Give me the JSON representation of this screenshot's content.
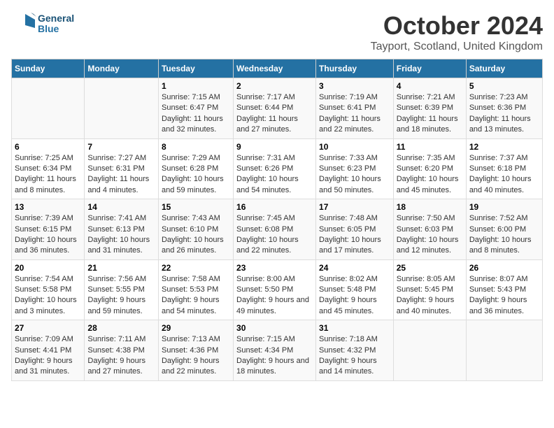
{
  "logo": {
    "line1": "General",
    "line2": "Blue"
  },
  "title": "October 2024",
  "subtitle": "Tayport, Scotland, United Kingdom",
  "headers": [
    "Sunday",
    "Monday",
    "Tuesday",
    "Wednesday",
    "Thursday",
    "Friday",
    "Saturday"
  ],
  "weeks": [
    [
      {
        "day": "",
        "sunrise": "",
        "sunset": "",
        "daylight": ""
      },
      {
        "day": "",
        "sunrise": "",
        "sunset": "",
        "daylight": ""
      },
      {
        "day": "1",
        "sunrise": "Sunrise: 7:15 AM",
        "sunset": "Sunset: 6:47 PM",
        "daylight": "Daylight: 11 hours and 32 minutes."
      },
      {
        "day": "2",
        "sunrise": "Sunrise: 7:17 AM",
        "sunset": "Sunset: 6:44 PM",
        "daylight": "Daylight: 11 hours and 27 minutes."
      },
      {
        "day": "3",
        "sunrise": "Sunrise: 7:19 AM",
        "sunset": "Sunset: 6:41 PM",
        "daylight": "Daylight: 11 hours and 22 minutes."
      },
      {
        "day": "4",
        "sunrise": "Sunrise: 7:21 AM",
        "sunset": "Sunset: 6:39 PM",
        "daylight": "Daylight: 11 hours and 18 minutes."
      },
      {
        "day": "5",
        "sunrise": "Sunrise: 7:23 AM",
        "sunset": "Sunset: 6:36 PM",
        "daylight": "Daylight: 11 hours and 13 minutes."
      }
    ],
    [
      {
        "day": "6",
        "sunrise": "Sunrise: 7:25 AM",
        "sunset": "Sunset: 6:34 PM",
        "daylight": "Daylight: 11 hours and 8 minutes."
      },
      {
        "day": "7",
        "sunrise": "Sunrise: 7:27 AM",
        "sunset": "Sunset: 6:31 PM",
        "daylight": "Daylight: 11 hours and 4 minutes."
      },
      {
        "day": "8",
        "sunrise": "Sunrise: 7:29 AM",
        "sunset": "Sunset: 6:28 PM",
        "daylight": "Daylight: 10 hours and 59 minutes."
      },
      {
        "day": "9",
        "sunrise": "Sunrise: 7:31 AM",
        "sunset": "Sunset: 6:26 PM",
        "daylight": "Daylight: 10 hours and 54 minutes."
      },
      {
        "day": "10",
        "sunrise": "Sunrise: 7:33 AM",
        "sunset": "Sunset: 6:23 PM",
        "daylight": "Daylight: 10 hours and 50 minutes."
      },
      {
        "day": "11",
        "sunrise": "Sunrise: 7:35 AM",
        "sunset": "Sunset: 6:20 PM",
        "daylight": "Daylight: 10 hours and 45 minutes."
      },
      {
        "day": "12",
        "sunrise": "Sunrise: 7:37 AM",
        "sunset": "Sunset: 6:18 PM",
        "daylight": "Daylight: 10 hours and 40 minutes."
      }
    ],
    [
      {
        "day": "13",
        "sunrise": "Sunrise: 7:39 AM",
        "sunset": "Sunset: 6:15 PM",
        "daylight": "Daylight: 10 hours and 36 minutes."
      },
      {
        "day": "14",
        "sunrise": "Sunrise: 7:41 AM",
        "sunset": "Sunset: 6:13 PM",
        "daylight": "Daylight: 10 hours and 31 minutes."
      },
      {
        "day": "15",
        "sunrise": "Sunrise: 7:43 AM",
        "sunset": "Sunset: 6:10 PM",
        "daylight": "Daylight: 10 hours and 26 minutes."
      },
      {
        "day": "16",
        "sunrise": "Sunrise: 7:45 AM",
        "sunset": "Sunset: 6:08 PM",
        "daylight": "Daylight: 10 hours and 22 minutes."
      },
      {
        "day": "17",
        "sunrise": "Sunrise: 7:48 AM",
        "sunset": "Sunset: 6:05 PM",
        "daylight": "Daylight: 10 hours and 17 minutes."
      },
      {
        "day": "18",
        "sunrise": "Sunrise: 7:50 AM",
        "sunset": "Sunset: 6:03 PM",
        "daylight": "Daylight: 10 hours and 12 minutes."
      },
      {
        "day": "19",
        "sunrise": "Sunrise: 7:52 AM",
        "sunset": "Sunset: 6:00 PM",
        "daylight": "Daylight: 10 hours and 8 minutes."
      }
    ],
    [
      {
        "day": "20",
        "sunrise": "Sunrise: 7:54 AM",
        "sunset": "Sunset: 5:58 PM",
        "daylight": "Daylight: 10 hours and 3 minutes."
      },
      {
        "day": "21",
        "sunrise": "Sunrise: 7:56 AM",
        "sunset": "Sunset: 5:55 PM",
        "daylight": "Daylight: 9 hours and 59 minutes."
      },
      {
        "day": "22",
        "sunrise": "Sunrise: 7:58 AM",
        "sunset": "Sunset: 5:53 PM",
        "daylight": "Daylight: 9 hours and 54 minutes."
      },
      {
        "day": "23",
        "sunrise": "Sunrise: 8:00 AM",
        "sunset": "Sunset: 5:50 PM",
        "daylight": "Daylight: 9 hours and 49 minutes."
      },
      {
        "day": "24",
        "sunrise": "Sunrise: 8:02 AM",
        "sunset": "Sunset: 5:48 PM",
        "daylight": "Daylight: 9 hours and 45 minutes."
      },
      {
        "day": "25",
        "sunrise": "Sunrise: 8:05 AM",
        "sunset": "Sunset: 5:45 PM",
        "daylight": "Daylight: 9 hours and 40 minutes."
      },
      {
        "day": "26",
        "sunrise": "Sunrise: 8:07 AM",
        "sunset": "Sunset: 5:43 PM",
        "daylight": "Daylight: 9 hours and 36 minutes."
      }
    ],
    [
      {
        "day": "27",
        "sunrise": "Sunrise: 7:09 AM",
        "sunset": "Sunset: 4:41 PM",
        "daylight": "Daylight: 9 hours and 31 minutes."
      },
      {
        "day": "28",
        "sunrise": "Sunrise: 7:11 AM",
        "sunset": "Sunset: 4:38 PM",
        "daylight": "Daylight: 9 hours and 27 minutes."
      },
      {
        "day": "29",
        "sunrise": "Sunrise: 7:13 AM",
        "sunset": "Sunset: 4:36 PM",
        "daylight": "Daylight: 9 hours and 22 minutes."
      },
      {
        "day": "30",
        "sunrise": "Sunrise: 7:15 AM",
        "sunset": "Sunset: 4:34 PM",
        "daylight": "Daylight: 9 hours and 18 minutes."
      },
      {
        "day": "31",
        "sunrise": "Sunrise: 7:18 AM",
        "sunset": "Sunset: 4:32 PM",
        "daylight": "Daylight: 9 hours and 14 minutes."
      },
      {
        "day": "",
        "sunrise": "",
        "sunset": "",
        "daylight": ""
      },
      {
        "day": "",
        "sunrise": "",
        "sunset": "",
        "daylight": ""
      }
    ]
  ]
}
